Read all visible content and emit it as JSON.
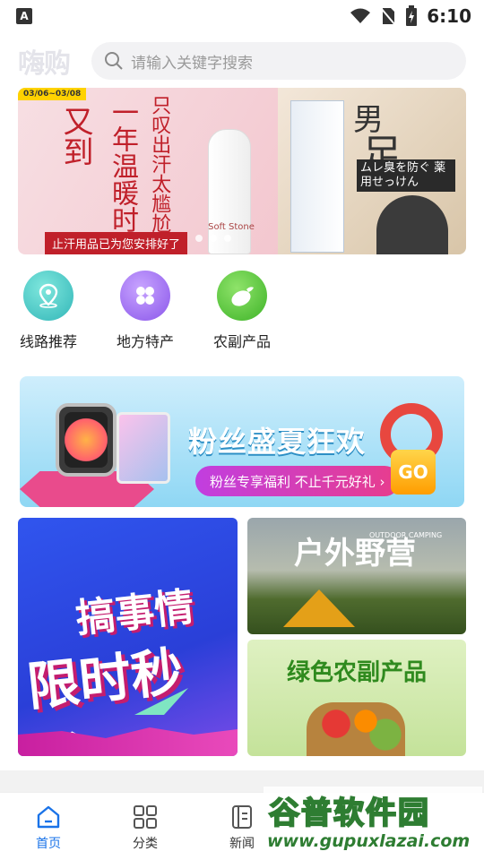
{
  "status_bar": {
    "time": "6:10",
    "app_badge": "A"
  },
  "header": {
    "logo": "嗨购",
    "search_placeholder": "请输入关键字搜索"
  },
  "banner": {
    "date_tag": "03/06~03/08",
    "left_title_1": "又到",
    "left_title_2": "一年温暖时",
    "left_title_3": "只叹出汗太尴尬",
    "left_bottom": "止汗用品已为您安排好了",
    "stick_label": "Soft Stone",
    "right_title_1": "男",
    "right_title_2": "足",
    "right_box": "ムレ臭を防ぐ 薬用せっけん"
  },
  "categories": [
    {
      "label": "线路推荐",
      "icon": "location-pin-icon",
      "color": "#37c6c0"
    },
    {
      "label": "地方特产",
      "icon": "clover-grid-icon",
      "color": "#9b6cf0"
    },
    {
      "label": "农副产品",
      "icon": "vegetable-icon",
      "color": "#4fc33a"
    }
  ],
  "promo": {
    "title": "粉丝盛夏狂欢",
    "subtitle": "粉丝专享福利 不止千元好礼 ›",
    "go": "GO"
  },
  "tiles": {
    "flash": {
      "line1": "搞事情",
      "line2": "限时秒杀"
    },
    "camp": {
      "title": "户外野营",
      "en": "OUTDOOR CAMPING"
    },
    "agri": {
      "title": "绿色农副产品"
    }
  },
  "tabbar": [
    {
      "label": "首页",
      "active": true
    },
    {
      "label": "分类",
      "active": false
    },
    {
      "label": "新闻",
      "active": false
    }
  ],
  "watermark": {
    "brand": "谷普软件园",
    "url": "www.gupuxlazai.com"
  }
}
